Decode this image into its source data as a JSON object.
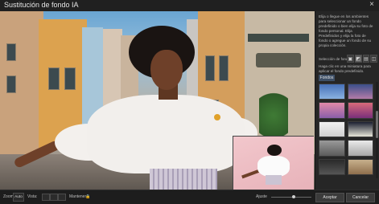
{
  "window": {
    "title": "Sustitución de fondo IA",
    "close_icon": "×"
  },
  "panel": {
    "description": "Elija o llegue en los ambientes para seleccionar un fondo predefinido o bien elija su foto de fondo personal. Elija Predefinidos y elija la foto de fondo o agregue un fondo de su propia colección.",
    "selection_label": "Selección de fondo",
    "tools": [
      "▣",
      "◩",
      "▤",
      "◫"
    ],
    "secondary_description": "Haga clic en una miniatura para aplicar el fondo predefinido.",
    "preset_tab": "Fondos",
    "scroll_fraction": 0.42,
    "thumbnails": [
      {
        "name": "thumb-sky-blue",
        "colors": [
          "#4670b8",
          "#8ab2e1"
        ]
      },
      {
        "name": "thumb-sky-dusk",
        "colors": [
          "#3b4f8a",
          "#b37ba7"
        ]
      },
      {
        "name": "thumb-sunset-pink",
        "colors": [
          "#e28aa8",
          "#8a5ea9"
        ]
      },
      {
        "name": "thumb-sunset-red",
        "colors": [
          "#d96a7b",
          "#7a2f7b"
        ]
      },
      {
        "name": "thumb-white",
        "colors": [
          "#f2f2f2",
          "#cfcfcf"
        ]
      },
      {
        "name": "thumb-night",
        "colors": [
          "#1b2030",
          "#e7e6d8"
        ]
      },
      {
        "name": "thumb-gray-studio",
        "colors": [
          "#9a9a9a",
          "#5b5b5b"
        ]
      },
      {
        "name": "thumb-light-studio",
        "colors": [
          "#eaeaea",
          "#a7a7a7"
        ]
      },
      {
        "name": "thumb-dark",
        "colors": [
          "#2a2a2a",
          "#555555"
        ]
      },
      {
        "name": "thumb-warm",
        "colors": [
          "#c7b08c",
          "#8e6e4c"
        ]
      }
    ]
  },
  "bottom": {
    "zoom_label": "Zoom:",
    "zoom_value": "Auto",
    "view_label": "Vista:",
    "compare_label": "Mantener",
    "lock_icon": "🔒",
    "slider_label": "Ajuste",
    "slider_value": 0.55,
    "ok_button": "Aceptar",
    "cancel_button": "Cancelar"
  }
}
